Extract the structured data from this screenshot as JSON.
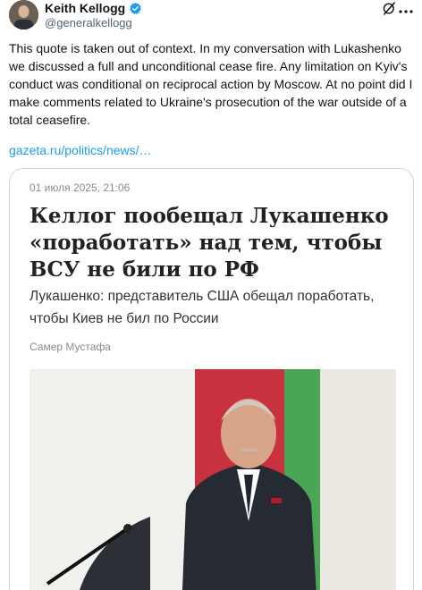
{
  "author": {
    "name": "Keith Kellogg",
    "handle": "@generalkellogg"
  },
  "tweet": {
    "text": "This quote is taken out of context. In my conversation with Lukashenko we discussed a full and unconditional cease fire. Any limitation on Kyiv's conduct was conditional on reciprocal action by Moscow. At no point did I make comments related to Ukraine's prosecution of the war outside of a total ceasefire.",
    "link": "gazeta.ru/politics/news/…"
  },
  "card": {
    "date": "01 июля 2025, 21:06",
    "headline": "Келлог пообещал Лукашенко «поработать» над тем, чтобы ВСУ не били по РФ",
    "subtitle": "Лукашенко: представитель США обещал поработать, чтобы Киев не бил по России",
    "byline": "Самер Мустафа"
  },
  "icons": {
    "verified": "verified-badge-icon",
    "grok": "grok-icon",
    "more": "more-options-icon"
  },
  "colors": {
    "verified": "#1d9bf0",
    "link": "#1d9bf0",
    "flag_red": "#c8313e",
    "flag_green": "#4aa657"
  }
}
